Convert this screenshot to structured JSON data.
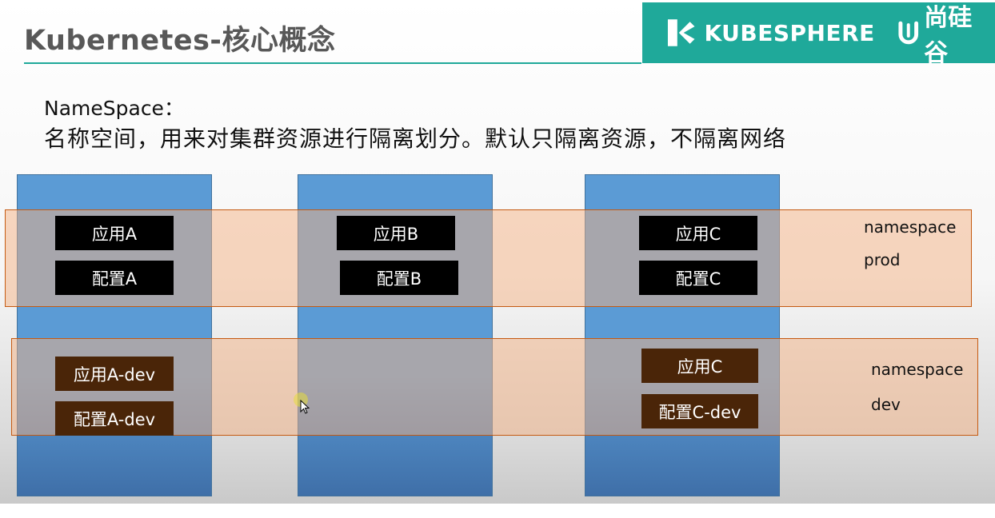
{
  "header": {
    "title": "Kubernetes-核心概念",
    "brand_kubesphere": "KUBESPHERE",
    "brand_sgg": "尚硅谷"
  },
  "intro": {
    "heading": "NameSpace：",
    "description": "名称空间，用来对集群资源进行隔离划分。默认只隔离资源，不隔离网络"
  },
  "namespaces": {
    "prod": {
      "label_line1": "namespace",
      "label_line2": "prod",
      "boxes": [
        "应用A",
        "配置A",
        "应用B",
        "配置B",
        "应用C",
        "配置C"
      ]
    },
    "dev": {
      "label_line1": "namespace",
      "label_line2": "dev",
      "boxes": [
        "应用A-dev",
        "配置A-dev",
        "应用C",
        "配置C-dev"
      ]
    }
  },
  "colors": {
    "accent": "#1fa99a",
    "column": "#5b9bd5",
    "band": "#f4b183",
    "band_border": "#c55a11",
    "box_prod": "#000000",
    "box_dev": "#4a2508"
  },
  "icons": [
    "kubesphere-logo-icon",
    "atguigu-logo-icon",
    "mouse-cursor-icon"
  ]
}
